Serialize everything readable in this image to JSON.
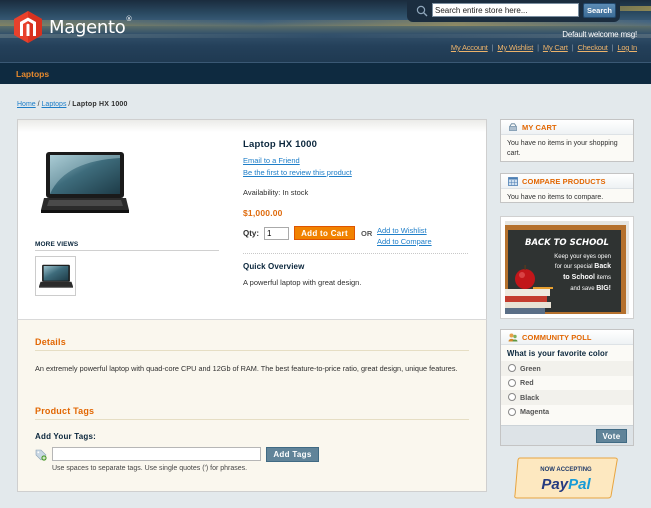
{
  "header": {
    "logo_text": "Magento",
    "logo_mark": "®",
    "search": {
      "placeholder": "Search entire store here...",
      "value": "Search entire store here...",
      "button_label": "Search"
    },
    "welcome": "Default welcome msg!",
    "links": [
      "My Account",
      "My Wishlist",
      "My Cart",
      "Checkout",
      "Log In"
    ]
  },
  "nav": {
    "items": [
      "Laptops"
    ]
  },
  "breadcrumbs": {
    "home": "Home",
    "category": "Laptops",
    "current": "Laptop HX 1000"
  },
  "product": {
    "name": "Laptop HX 1000",
    "email_link": "Email to a Friend",
    "review_link": "Be the first to review this product",
    "availability": "Availability: In stock",
    "price": "$1,000.00",
    "qty_label": "Qty:",
    "qty_value": "1",
    "add_to_cart": "Add to Cart",
    "or": "OR",
    "add_to_wishlist": "Add to Wishlist",
    "add_to_compare": "Add to Compare",
    "quick_overview_title": "Quick Overview",
    "quick_overview_text": "A powerful laptop with great design.",
    "more_views": "MORE VIEWS"
  },
  "details": {
    "title": "Details",
    "text": "An extremely powerful laptop with quad-core CPU and 12Gb of RAM. The best feature-to-price ratio, great design, unique features."
  },
  "tags": {
    "title": "Product Tags",
    "label": "Add Your Tags:",
    "input_value": "",
    "button_label": "Add Tags",
    "hint": "Use spaces to separate tags. Use single quotes (') for phrases."
  },
  "sidebar": {
    "cart": {
      "title": "MY CART",
      "text": "You have no items in your shopping cart."
    },
    "compare": {
      "title": "COMPARE PRODUCTS",
      "text": "You have no items to compare."
    },
    "banner": {
      "heading": "BACK TO SCHOOL",
      "line1": "Keep your eyes open",
      "line2a": "for our special ",
      "line2b": "Back",
      "line3a": "to School",
      "line3b": " items",
      "line4a": "and save ",
      "line4b": "BIG!"
    },
    "poll": {
      "title": "COMMUNITY POLL",
      "question": "What is your favorite color",
      "options": [
        "Green",
        "Red",
        "Black",
        "Magenta"
      ],
      "vote_label": "Vote"
    },
    "paypal": {
      "line1": "NOW ACCEPTING",
      "brand_a": "Pay",
      "brand_b": "Pal"
    }
  },
  "colors": {
    "accent_orange": "#e26703",
    "link_blue": "#1e7ec8",
    "cart_button": "#f18200",
    "header_navy": "#1f3a52"
  }
}
